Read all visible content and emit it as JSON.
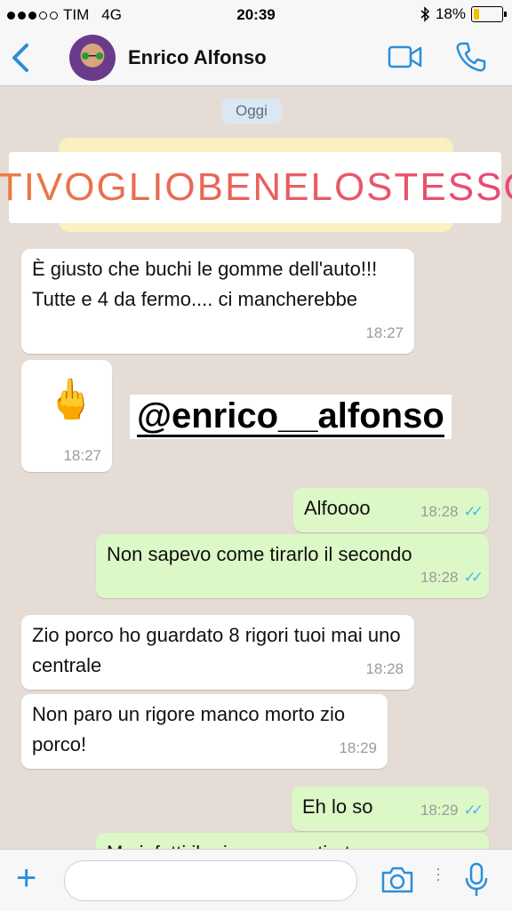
{
  "status_bar": {
    "carrier": "TIM",
    "network": "4G",
    "time": "20:39",
    "battery": "18%",
    "battery_level": 0.18
  },
  "header": {
    "contact_name": "Enrico Alfonso"
  },
  "chat": {
    "day_label": "Oggi",
    "hashtag_sticker": "#TIVOGLIOBENELOSTESSO",
    "mention_sticker": "@enrico__alfonso",
    "messages": [
      {
        "dir": "in",
        "text": "È giusto che buchi le gomme dell'auto!!! Tutte e 4 da fermo.... ci mancherebbe",
        "time": "18:27"
      },
      {
        "dir": "in",
        "text": "🖕",
        "time": "18:27"
      },
      {
        "dir": "out",
        "text": "Alfoooo",
        "time": "18:28"
      },
      {
        "dir": "out",
        "text": "Non sapevo come tirarlo il secondo",
        "time": "18:28"
      },
      {
        "dir": "in",
        "text": "Zio porco ho guardato 8 rigori tuoi mai uno centrale",
        "time": "18:28"
      },
      {
        "dir": "in",
        "text": "Non paro un rigore manco morto zio porco!",
        "time": "18:29"
      },
      {
        "dir": "out",
        "text": "Eh lo so",
        "time": "18:29"
      },
      {
        "dir": "out",
        "text": "Ma infatti il primo avevo tirato come",
        "time": ""
      }
    ]
  },
  "icons": {
    "back": "chevron-left-icon",
    "video": "video-camera-icon",
    "call": "phone-icon",
    "add": "plus-icon",
    "camera": "camera-icon",
    "mic": "microphone-icon"
  },
  "colors": {
    "accent": "#2a8fd8",
    "outgoing_bubble": "#dcf8c6",
    "incoming_bubble": "#ffffff",
    "read_ticks": "#4fb6ec"
  }
}
